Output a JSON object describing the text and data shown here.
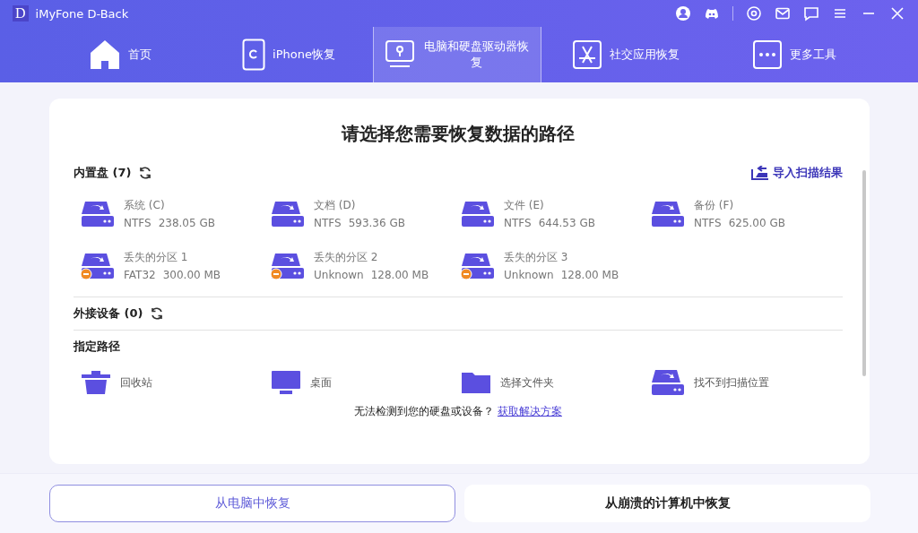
{
  "window": {
    "logo_letter": "D",
    "title": "iMyFone D-Back"
  },
  "nav_tabs": [
    {
      "label": "首页",
      "kind": "home",
      "selected": false
    },
    {
      "label": "iPhone恢复",
      "kind": "phone",
      "selected": false
    },
    {
      "label": "电脑和硬盘驱动器恢复",
      "kind": "pc",
      "selected": true
    },
    {
      "label": "社交应用恢复",
      "kind": "app",
      "selected": false
    },
    {
      "label": "更多工具",
      "kind": "more",
      "selected": false
    }
  ],
  "card": {
    "title": "请选择您需要恢复数据的路径",
    "internal": {
      "label": "内置盘 (7)",
      "import_button": "导入扫描结果",
      "drives": [
        {
          "name": "系统 (C)",
          "fs": "NTFS",
          "size": "238.05 GB",
          "lost": false
        },
        {
          "name": "文档 (D)",
          "fs": "NTFS",
          "size": "593.36 GB",
          "lost": false
        },
        {
          "name": "文件 (E)",
          "fs": "NTFS",
          "size": "644.53 GB",
          "lost": false
        },
        {
          "name": "备份 (F)",
          "fs": "NTFS",
          "size": "625.00 GB",
          "lost": false
        },
        {
          "name": "丢失的分区 1",
          "fs": "FAT32",
          "size": "300.00 MB",
          "lost": true
        },
        {
          "name": "丢失的分区 2",
          "fs": "Unknown",
          "size": "128.00 MB",
          "lost": true
        },
        {
          "name": "丢失的分区 3",
          "fs": "Unknown",
          "size": "128.00 MB",
          "lost": true
        }
      ]
    },
    "external": {
      "label": "外接设备 (0)"
    },
    "paths": {
      "label": "指定路径",
      "items": [
        {
          "label": "回收站",
          "kind": "trash"
        },
        {
          "label": "桌面",
          "kind": "desktop"
        },
        {
          "label": "选择文件夹",
          "kind": "folder"
        },
        {
          "label": "找不到扫描位置",
          "kind": "drive"
        }
      ]
    },
    "help": {
      "text": "无法检测到您的硬盘或设备？",
      "link": "获取解决方案"
    }
  },
  "bottom_buttons": [
    {
      "label": "从电脑中恢复",
      "selected": true
    },
    {
      "label": "从崩溃的计算机中恢复",
      "selected": false
    }
  ]
}
